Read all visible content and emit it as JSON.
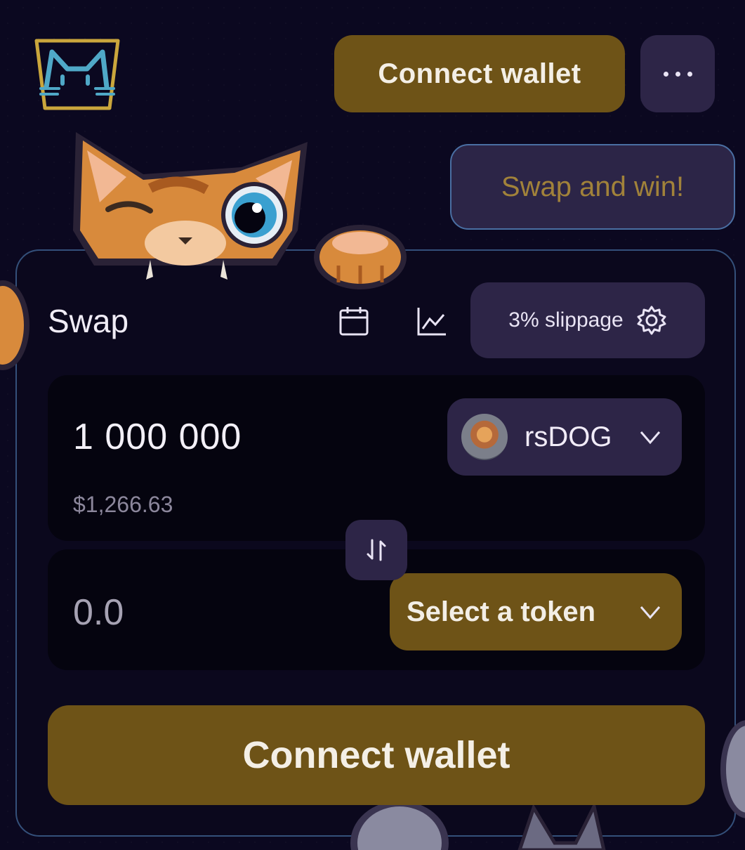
{
  "header": {
    "connect_wallet_label": "Connect wallet",
    "more_icon": "ellipsis-icon",
    "promo_label": "Swap and win!"
  },
  "swap": {
    "title": "Swap",
    "slippage_label": "3% slippage",
    "from": {
      "amount": "1 000 000",
      "usd_value": "$1,266.63",
      "token": "rsDOG"
    },
    "to": {
      "amount_placeholder": "0.0",
      "select_label": "Select a token"
    },
    "connect_wallet_label": "Connect wallet"
  },
  "colors": {
    "background": "#0b0820",
    "accent_gold": "#6e5317",
    "panel": "#2d2547",
    "border_blue": "#34507a"
  }
}
